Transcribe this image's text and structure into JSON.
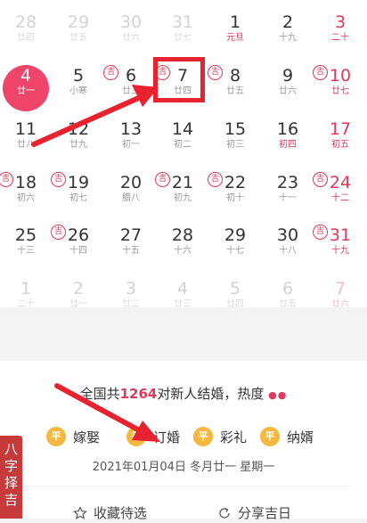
{
  "calendar": {
    "weeks": [
      [
        {
          "num": "28",
          "sub": "廿四",
          "dim": true
        },
        {
          "num": "29",
          "sub": "廿五",
          "dim": true
        },
        {
          "num": "30",
          "sub": "廿六",
          "dim": true
        },
        {
          "num": "31",
          "sub": "廿七",
          "dim": true
        },
        {
          "num": "1",
          "sub": "元旦",
          "red_sub": true
        },
        {
          "num": "2",
          "sub": "十九"
        },
        {
          "num": "3",
          "sub": "二十",
          "weekend": true
        }
      ],
      [
        {
          "num": "4",
          "sub": "廿一",
          "today": true
        },
        {
          "num": "5",
          "sub": "小寒"
        },
        {
          "num": "6",
          "sub": "廿三",
          "ji": true
        },
        {
          "num": "7",
          "sub": "廿四",
          "ji": true,
          "highlight": true
        },
        {
          "num": "8",
          "sub": "廿五",
          "ji": true
        },
        {
          "num": "9",
          "sub": "廿六"
        },
        {
          "num": "10",
          "sub": "廿七",
          "ji": true,
          "weekend": true
        }
      ],
      [
        {
          "num": "11",
          "sub": "廿八"
        },
        {
          "num": "12",
          "sub": "廿九"
        },
        {
          "num": "13",
          "sub": "初一"
        },
        {
          "num": "14",
          "sub": "初二"
        },
        {
          "num": "15",
          "sub": "初三"
        },
        {
          "num": "16",
          "sub": "初四",
          "red_sub": true
        },
        {
          "num": "17",
          "sub": "初五",
          "weekend": true
        }
      ],
      [
        {
          "num": "18",
          "sub": "初六",
          "ji": true
        },
        {
          "num": "19",
          "sub": "初七",
          "ji": true
        },
        {
          "num": "20",
          "sub": "腊八"
        },
        {
          "num": "21",
          "sub": "初九",
          "ji": true
        },
        {
          "num": "22",
          "sub": "初十",
          "ji": true
        },
        {
          "num": "23",
          "sub": "十一"
        },
        {
          "num": "24",
          "sub": "十二",
          "ji": true,
          "weekend": true
        }
      ],
      [
        {
          "num": "25",
          "sub": "十三"
        },
        {
          "num": "26",
          "sub": "十四",
          "ji": true
        },
        {
          "num": "27",
          "sub": "十五"
        },
        {
          "num": "28",
          "sub": "十六"
        },
        {
          "num": "29",
          "sub": "十七"
        },
        {
          "num": "30",
          "sub": "十八"
        },
        {
          "num": "31",
          "sub": "十九",
          "ji": true,
          "weekend": true
        }
      ],
      [
        {
          "num": "1",
          "sub": "二十",
          "dim": true
        },
        {
          "num": "2",
          "sub": "廿一",
          "dim": true
        },
        {
          "num": "3",
          "sub": "廿二",
          "dim": true
        },
        {
          "num": "4",
          "sub": "廿三",
          "dim": true
        },
        {
          "num": "5",
          "sub": "廿四",
          "dim": true
        },
        {
          "num": "6",
          "sub": "廿五",
          "dim": true
        },
        {
          "num": "7",
          "sub": "廿六",
          "dim": true,
          "weekend": true
        }
      ]
    ],
    "ji_label": "吉"
  },
  "stats": {
    "prefix": "全国共",
    "count": "1264",
    "suffix": "对新人结婚，热度",
    "drops": "●●"
  },
  "tags": [
    {
      "badge": "平",
      "label": "嫁娶"
    },
    {
      "badge": "平",
      "label": "订婚"
    },
    {
      "badge": "平",
      "label": "彩礼"
    },
    {
      "badge": "平",
      "label": "纳婿"
    }
  ],
  "date_line": "2021年01月04日 冬月廿一 星期一",
  "actions": {
    "favorite": "收藏待选",
    "share": "分享吉日"
  },
  "side_tab": "八字择吉",
  "colors": {
    "accent": "#e0395a",
    "today": "#f0456a",
    "badge": "#f6b73c",
    "side": "#c63a3a",
    "arrow": "#e8222e"
  }
}
